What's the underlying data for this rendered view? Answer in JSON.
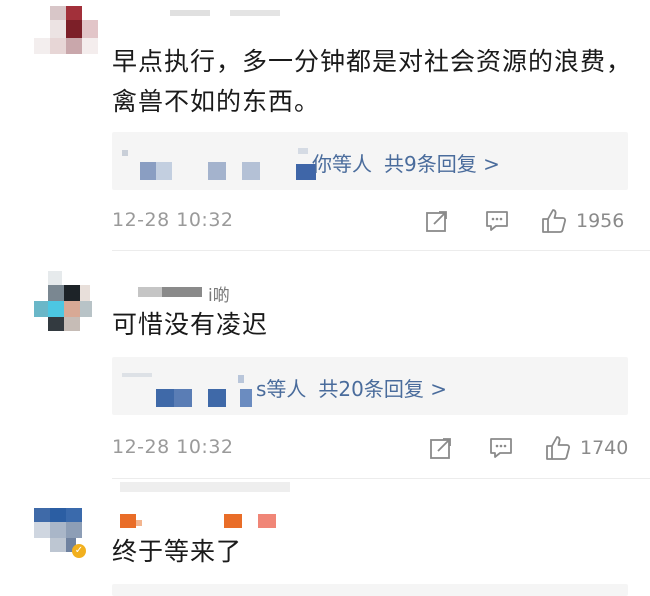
{
  "comments": [
    {
      "text": "早点执行，多一分钟都是对社会资源的浪费，禽兽不如的东西。",
      "reply_names_tail": "你等人",
      "reply_count": "共9条回复 >",
      "timestamp": "12-28 10:32",
      "likes": "1956"
    },
    {
      "username_fragment": "ⅰ啲",
      "text": "可惜没有凌迟",
      "reply_names_tail": "s等人",
      "reply_count": "共20条回复 >",
      "timestamp": "12-28 10:32",
      "likes": "1740"
    },
    {
      "text": "终于等来了"
    }
  ],
  "colors": {
    "link_blue": "#4a6c9c",
    "meta_gray": "#9a9a9a",
    "reply_bg": "#f5f5f5",
    "vip_badge": "#f2b01e"
  },
  "icons": [
    "share-icon",
    "comment-icon",
    "thumbs-up-icon",
    "verified-badge-icon"
  ]
}
